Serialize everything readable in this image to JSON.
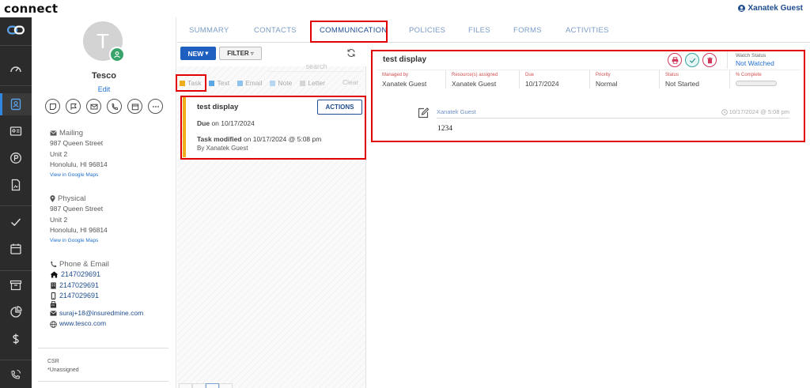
{
  "app": {
    "brand": "connect",
    "user_name": "Xanatek Guest"
  },
  "contact": {
    "avatar_initial": "T",
    "name": "Tesco",
    "edit_label": "Edit",
    "mailing": {
      "heading": "Mailing",
      "line1": "987 Queen Street",
      "line2": "Unit 2",
      "line3": "Honolulu, HI 96814",
      "map_link": "View in Google Maps"
    },
    "physical": {
      "heading": "Physical",
      "line1": "987 Queen Street",
      "line2": "Unit 2",
      "line3": "Honolulu, HI 96814",
      "map_link": "View in Google Maps"
    },
    "phone_email": {
      "heading": "Phone & Email",
      "home_phone": "2147029691",
      "work_phone": "2147029691",
      "mobile_phone": "2147029691",
      "email": "suraj+18@insuredmine.com",
      "website": "www.tesco.com"
    },
    "csr_label": "CSR",
    "csr_value": "*Unassigned"
  },
  "tabs": {
    "summary": "SUMMARY",
    "contacts": "CONTACTS",
    "communication": "COMMUNICATION",
    "policies": "POLICIES",
    "files": "FILES",
    "forms": "FORMS",
    "activities": "ACTIVITIES"
  },
  "toolbar": {
    "new_label": "NEW",
    "filter_label": "FILTER",
    "search_placeholder": "search"
  },
  "type_filters": {
    "task": {
      "label": "Task",
      "color": "#f0ad1c"
    },
    "text": {
      "label": "Text",
      "color": "#5aa7e6"
    },
    "email": {
      "label": "Email",
      "color": "#8fc3ee"
    },
    "note": {
      "label": "Note",
      "color": "#b8d6f1"
    },
    "letter": {
      "label": "Letter",
      "color": "#d5d5d5"
    },
    "clear": "Clear"
  },
  "task_card": {
    "title": "test display",
    "actions_label": "ACTIONS",
    "due_label": "Due",
    "due_value": "on 10/17/2024",
    "modified_label": "Task modified",
    "modified_value": "on 10/17/2024 @ 5:08 pm",
    "by": "By Xanatek Guest",
    "accent": "#f0ad1c"
  },
  "detail": {
    "title": "test display",
    "watch_label": "Watch Status",
    "watch_value": "Not Watched",
    "fields": {
      "managed_by": {
        "label": "Managed by",
        "value": "Xanatek Guest"
      },
      "resources": {
        "label": "Resource(s) assigned",
        "value": "Xanatek Guest"
      },
      "due": {
        "label": "Due",
        "value": "10/17/2024"
      },
      "priority": {
        "label": "Priority",
        "value": "Normal"
      },
      "status": {
        "label": "Status",
        "value": "Not Started"
      },
      "complete": {
        "label": "% Complete",
        "percent": 0
      }
    },
    "note": {
      "author": "Xanatek Guest",
      "timestamp": "10/17/2024 @ 5:08 pm",
      "body": "1234"
    }
  },
  "colors": {
    "primary": "#1f5fbf",
    "link": "#1f6fd1",
    "annotation": "#e00000",
    "rail_bg": "#2b2b2b"
  }
}
